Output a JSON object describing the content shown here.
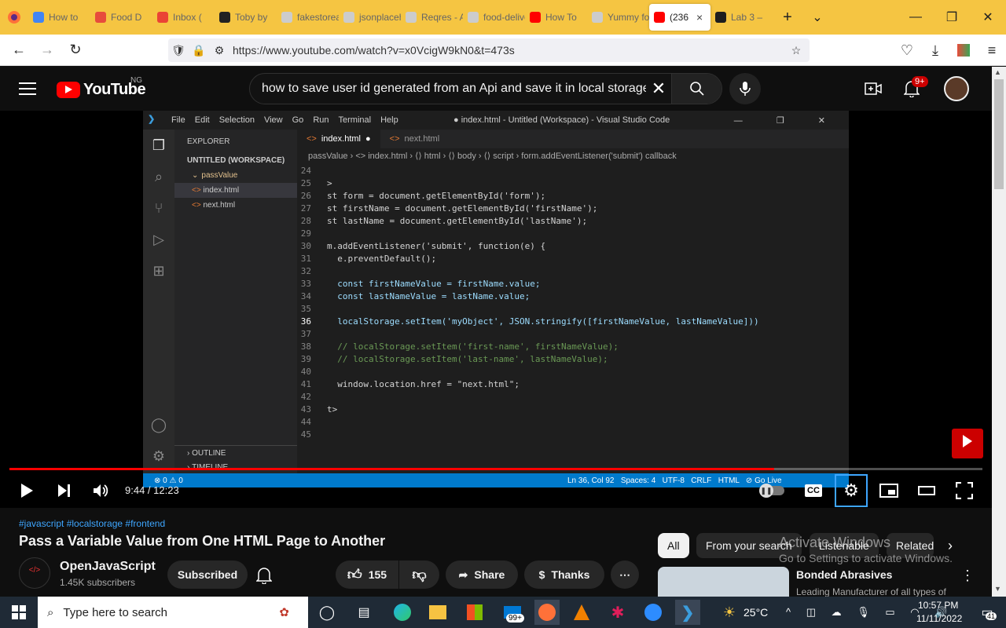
{
  "browser": {
    "tabs": [
      {
        "label": "How to",
        "color": "#4285f4"
      },
      {
        "label": "Food D",
        "color": "#e74c3c"
      },
      {
        "label": "Inbox (",
        "color": "#ea4335"
      },
      {
        "label": "Toby by",
        "color": "#222222"
      },
      {
        "label": "fakestoreap",
        "color": "#cccccc"
      },
      {
        "label": "jsonplaceh",
        "color": "#cccccc"
      },
      {
        "label": "Reqres - A",
        "color": "#cccccc"
      },
      {
        "label": "food-delive",
        "color": "#cccccc"
      },
      {
        "label": "How To",
        "color": "#ff0000"
      },
      {
        "label": "Yummy fo",
        "color": "#cccccc"
      }
    ],
    "active_tab": {
      "label": "(236",
      "close": "×"
    },
    "last_tab": {
      "label": "Lab 3 –"
    },
    "new_tab": "+",
    "url": "https://www.youtube.com/watch?v=x0VcigW9kN0&t=473s"
  },
  "youtube": {
    "logo_text": "YouTube",
    "region": "NG",
    "search_query": "how to save user id generated from an Api and save it in local storage",
    "notif_count": "9+"
  },
  "vscode": {
    "menu": [
      "File",
      "Edit",
      "Selection",
      "View",
      "Go",
      "Run",
      "Terminal",
      "Help"
    ],
    "title": "● index.html - Untitled (Workspace) - Visual Studio Code",
    "explorer_label": "EXPLORER",
    "workspace": "UNTITLED (WORKSPACE)",
    "folder": "passValue",
    "files": [
      "index.html",
      "next.html"
    ],
    "outline": "OUTLINE",
    "timeline": "TIMELINE",
    "tabs": [
      "index.html",
      "next.html"
    ],
    "breadcrumb": "passValue › <> index.html › ⟨⟩ html › ⟨⟩ body › ⟨⟩ script › form.addEventListener('submit') callback",
    "lines": [
      {
        "n": "24",
        "t": ""
      },
      {
        "n": "25",
        "t": ">"
      },
      {
        "n": "26",
        "t": "st form = document.getElementById('form');"
      },
      {
        "n": "27",
        "t": "st firstName = document.getElementById('firstName');"
      },
      {
        "n": "28",
        "t": "st lastName = document.getElementById('lastName');"
      },
      {
        "n": "29",
        "t": ""
      },
      {
        "n": "30",
        "t": "m.addEventListener('submit', function(e) {"
      },
      {
        "n": "31",
        "t": "  e.preventDefault();"
      },
      {
        "n": "32",
        "t": ""
      },
      {
        "n": "33",
        "t": "  const firstNameValue = firstName.value;"
      },
      {
        "n": "34",
        "t": "  const lastNameValue = lastName.value;"
      },
      {
        "n": "35",
        "t": ""
      },
      {
        "n": "36",
        "t": "  localStorage.setItem('myObject', JSON.stringify([firstNameValue, lastNameValue]))"
      },
      {
        "n": "37",
        "t": ""
      },
      {
        "n": "38",
        "t": "  // localStorage.setItem('first-name', firstNameValue);"
      },
      {
        "n": "39",
        "t": "  // localStorage.setItem('last-name', lastNameValue);"
      },
      {
        "n": "40",
        "t": ""
      },
      {
        "n": "41",
        "t": "  window.location.href = \"next.html\";"
      },
      {
        "n": "42",
        "t": ""
      },
      {
        "n": "43",
        "t": "t>"
      },
      {
        "n": "44",
        "t": ""
      },
      {
        "n": "45",
        "t": ""
      }
    ],
    "status_left": "⊗ 0 ⚠ 0",
    "status_right": "Ln 36, Col 92   Spaces: 4   UTF-8   CRLF   HTML   ⊘ Go Live"
  },
  "player": {
    "time": "9:44 / 12:23",
    "played_fraction": 0.786,
    "buffered_fraction": 0.39,
    "cc": "CC"
  },
  "video": {
    "tags": "#javascript #localstorage #frontend",
    "title": "Pass a Variable Value from One HTML Page to Another",
    "channel": "OpenJavaScript",
    "subscribers": "1.45K subscribers",
    "subscribed_label": "Subscribed",
    "likes": "155",
    "share": "Share",
    "thanks": "Thanks"
  },
  "chips": [
    "All",
    "From your search",
    "Listenable",
    "Related"
  ],
  "activation": {
    "line1": "Activate Windows",
    "line2": "Go to Settings to activate Windows."
  },
  "recommendation": {
    "title": "Bonded Abrasives",
    "subtitle": "Leading Manufacturer of all types of"
  },
  "taskbar": {
    "search_placeholder": "Type here to search",
    "mail_badge": "99+",
    "weather": "25°C",
    "time": "10:57 PM",
    "date": "11/11/2022",
    "notif": "41"
  }
}
